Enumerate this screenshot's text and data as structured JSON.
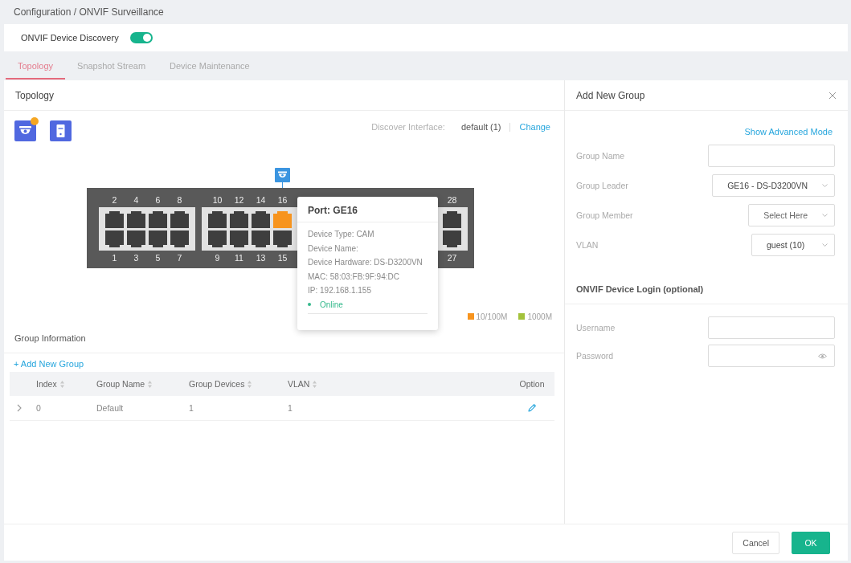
{
  "breadcrumb": "Configuration / ONVIF Surveillance",
  "discovery": {
    "label": "ONVIF Device Discovery",
    "on": true
  },
  "tabs": [
    {
      "label": "Topology",
      "selected": true
    },
    {
      "label": "Snapshot Stream",
      "selected": false
    },
    {
      "label": "Device Maintenance",
      "selected": false
    }
  ],
  "topology": {
    "title": "Topology",
    "devices": [
      {
        "kind": "camera",
        "alert": true
      },
      {
        "kind": "recorder",
        "alert": false
      }
    ],
    "discover_interface": {
      "label": "Discover Interface:",
      "value": "default (1)",
      "action": "Change"
    },
    "switch": {
      "groups": [
        {
          "columns": [
            {
              "top": {
                "number": "2",
                "connected": false
              },
              "bottom": {
                "number": "1",
                "connected": false
              }
            },
            {
              "top": {
                "number": "4",
                "connected": false
              },
              "bottom": {
                "number": "3",
                "connected": false
              }
            },
            {
              "top": {
                "number": "6",
                "connected": false
              },
              "bottom": {
                "number": "5",
                "connected": false
              }
            },
            {
              "top": {
                "number": "8",
                "connected": false
              },
              "bottom": {
                "number": "7",
                "connected": false
              }
            }
          ]
        },
        {
          "columns": [
            {
              "top": {
                "number": "10",
                "connected": false
              },
              "bottom": {
                "number": "9",
                "connected": false
              }
            },
            {
              "top": {
                "number": "12",
                "connected": false
              },
              "bottom": {
                "number": "11",
                "connected": false
              }
            },
            {
              "top": {
                "number": "14",
                "connected": false
              },
              "bottom": {
                "number": "13",
                "connected": false
              }
            },
            {
              "top": {
                "number": "16",
                "connected": true,
                "color": "#f7941e",
                "device": {
                  "kind": "camera"
                }
              },
              "bottom": {
                "number": "15",
                "connected": false
              }
            }
          ]
        },
        {
          "columns": [
            {
              "top": {
                "number": "28",
                "connected": false
              },
              "bottom": {
                "number": "27",
                "connected": false
              }
            }
          ]
        }
      ]
    },
    "tooltip": {
      "title": "Port: GE16",
      "lines": [
        "Device Type: CAM",
        "Device Name:",
        "Device Hardware: DS-D3200VN",
        "MAC: 58:03:FB:9F:94:DC",
        "IP: 192.168.1.155"
      ],
      "status": {
        "label": "Online",
        "online": true
      }
    },
    "legend": [
      {
        "label": "10/100M",
        "color": "#f7941e"
      },
      {
        "label": "1000M",
        "color": "#a3c23b"
      }
    ]
  },
  "group_information": {
    "title": "Group Information",
    "add_link": "+ Add New Group",
    "columns": [
      {
        "label": "Index",
        "sortable": true
      },
      {
        "label": "Group Name",
        "sortable": true
      },
      {
        "label": "Group Devices",
        "sortable": true
      },
      {
        "label": "VLAN",
        "sortable": true
      },
      {
        "label": "Option",
        "sortable": false
      }
    ],
    "rows": [
      {
        "expanded": false,
        "cells": [
          "0",
          "Default",
          "1",
          "1"
        ]
      }
    ]
  },
  "add_group_panel": {
    "title": "Add New Group",
    "advanced_link": "Show Advanced Mode",
    "fields": [
      {
        "label": "Group Name",
        "kind": "input"
      },
      {
        "label": "Group Leader",
        "kind": "select",
        "value": "GE16 - DS-D3200VN"
      },
      {
        "label": "Group Member",
        "kind": "select",
        "placeholder": "Select Here"
      },
      {
        "label": "VLAN",
        "kind": "select",
        "value": "guest (10)"
      }
    ],
    "login": {
      "title": "ONVIF Device Login (optional)",
      "fields": [
        {
          "label": "Username",
          "kind": "input"
        },
        {
          "label": "Password",
          "kind": "password"
        }
      ]
    }
  },
  "buttons": [
    {
      "label": "Cancel",
      "kind": "secondary"
    },
    {
      "label": "OK",
      "kind": "primary"
    }
  ]
}
